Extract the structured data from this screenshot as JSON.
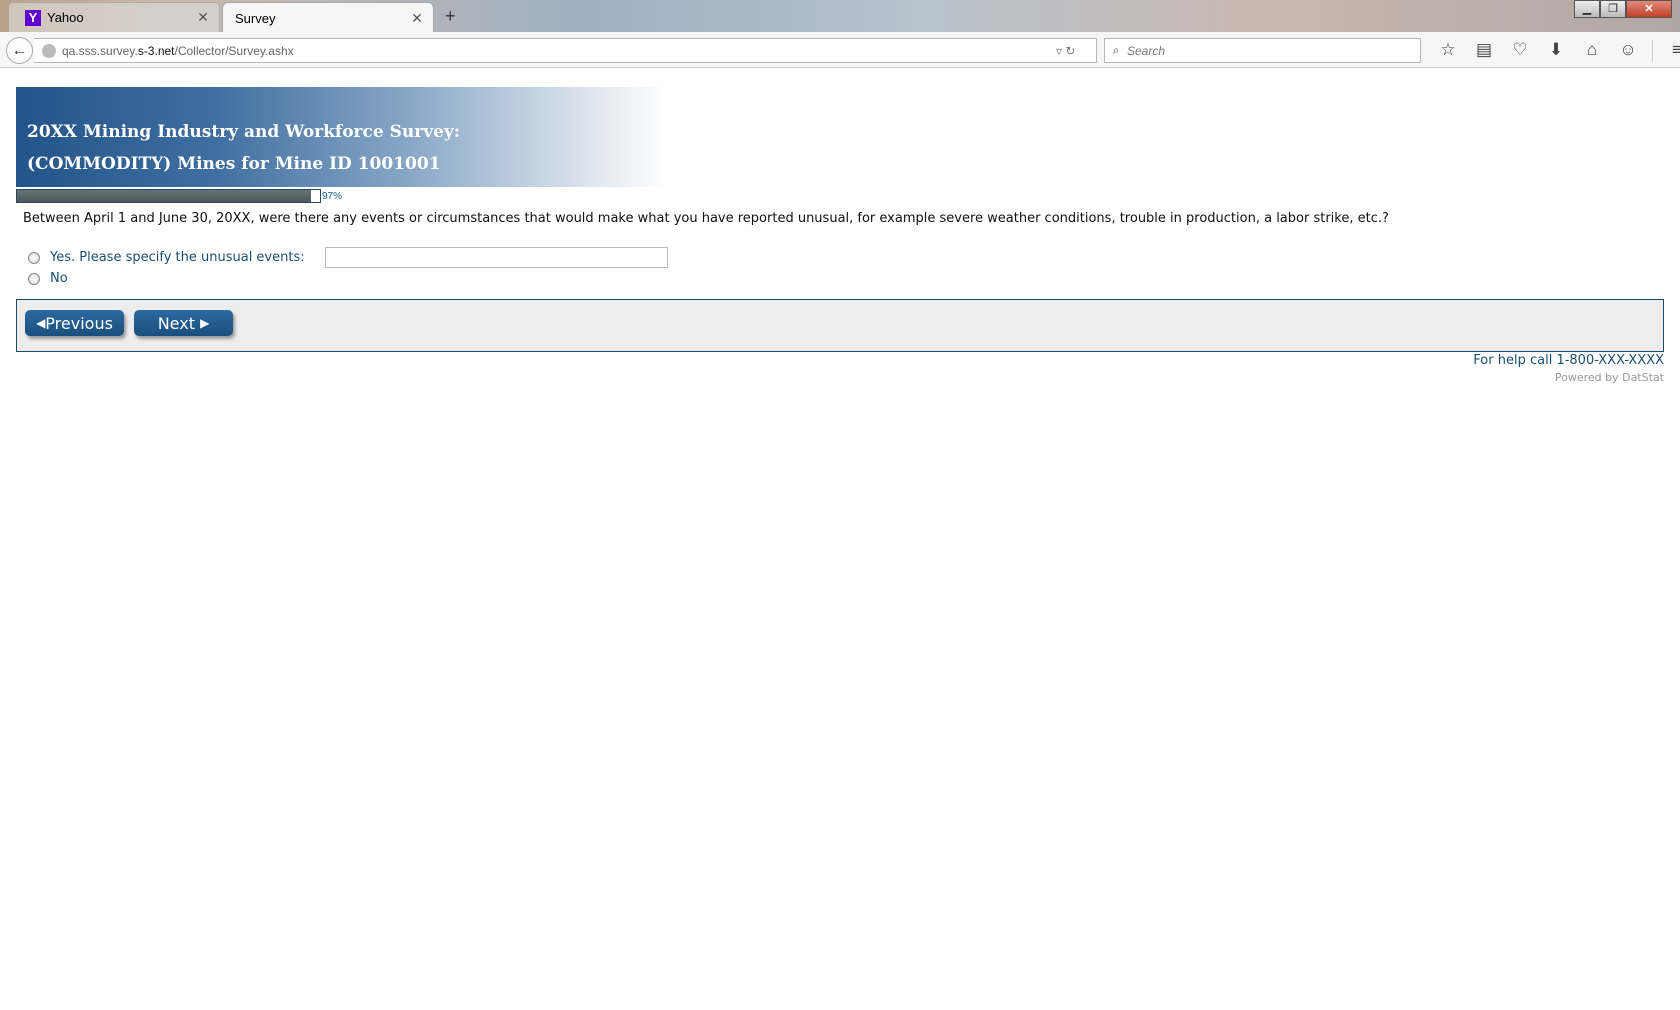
{
  "browser": {
    "tabs": [
      {
        "label": "Yahoo",
        "favicon": "Y",
        "active": false
      },
      {
        "label": "Survey",
        "active": true
      }
    ],
    "new_tab": "+",
    "url_prefix": "qa.sss.survey.",
    "url_domain": "s-3.net",
    "url_path": "/Collector/Survey.ashx",
    "search_placeholder": "Search"
  },
  "survey": {
    "title_line1": "20XX Mining Industry and Workforce Survey:",
    "title_line2": "(COMMODITY) Mines for Mine ID 1001001",
    "progress_percent": 97,
    "progress_label": "97%",
    "question": "Between April 1 and June 30, 20XX, were there any events or circumstances that would make what you have reported unusual, for example severe weather conditions, trouble in production, a labor strike, etc.?",
    "options": [
      {
        "label": "Yes. Please specify the unusual events:",
        "selected": false
      },
      {
        "label": "No",
        "selected": false
      }
    ],
    "other_input_value": "",
    "previous_label": "Previous",
    "next_label": "Next",
    "help_text": "For help call 1-800-XXX-XXXX",
    "powered_by": "Powered by DatStat"
  },
  "colors": {
    "banner_start": "#23548a",
    "button": "#1a4f7c",
    "link_text": "#1a4f70"
  }
}
